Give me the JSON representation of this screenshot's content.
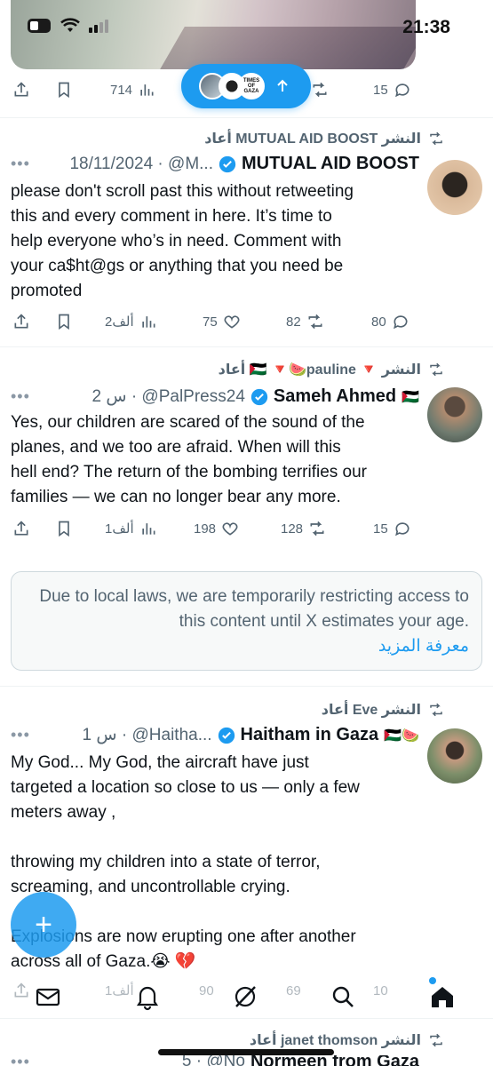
{
  "status_bar": {
    "time": "21:38"
  },
  "top_actions": {
    "views": "714",
    "replies": "15"
  },
  "new_posts_pill": {
    "avatar3_text": "TIMES OF GAZA"
  },
  "tweets": [
    {
      "repost_by": "أعاد MUTUAL AID BOOST النشر",
      "date": "18/11/2024 · @M...",
      "author": "MUTUAL AID BOOST",
      "text": "please don't scroll past this without retweeting\nthis and every comment in here. It’s time to\nhelp everyone who’s in need. Comment with\nyour ca$ht@gs  or anything that you need be\npromoted",
      "views": "2ألف",
      "likes": "75",
      "reposts": "82",
      "replies": "80"
    },
    {
      "repost_by": "أعاد 🇵🇸 🔻🍉pauline 🔻 النشر",
      "date": "2 س · @PalPress24",
      "author": "Sameh Ahmed",
      "author_flags": "🇵🇸",
      "text": "Yes, our children are scared of the sound of the\nplanes, and we too are afraid. When will this\nhell end? The return of the bombing terrifies our\nfamilies — we can no longer bear any more.",
      "views": "1ألف",
      "likes": "198",
      "reposts": "128",
      "replies": "15"
    },
    {
      "repost_by": "أعاد Eve النشر",
      "date": "1 س · @Haitha...",
      "author": "Haitham in Gaza",
      "author_flags": "🇵🇸🍉",
      "text": "My God... My God, the aircraft have just\ntargeted a location so close to us — only a few\nmeters away ,\n\nthrowing my children into a state of terror,\nscreaming, and uncontrollable crying.\n\nExplosions are now erupting one after another\nacross all of Gaza.😭 💔",
      "views": "1ألف",
      "likes": "90",
      "reposts": "69",
      "replies": "10"
    },
    {
      "repost_by": "أعاد janet thomson النشر",
      "date": "5 · @No",
      "author": "Normeen from Gaza"
    }
  ],
  "restricted": {
    "message": "Due to local laws, we are temporarily restricting access to this content until X estimates your age.",
    "link": "معرفة المزيد"
  },
  "fab": {
    "label": "+"
  },
  "icons": {
    "share": "share-icon",
    "bookmark": "bookmark-icon",
    "views": "views-icon",
    "like": "heart-icon",
    "repost": "repost-icon",
    "reply": "reply-icon",
    "verified": "verified-badge-icon",
    "nav": [
      "mail-icon",
      "bell-icon",
      "grok-icon",
      "search-icon",
      "home-icon"
    ]
  },
  "colors": {
    "accent": "#1d9bf0",
    "text_secondary": "#536471"
  }
}
